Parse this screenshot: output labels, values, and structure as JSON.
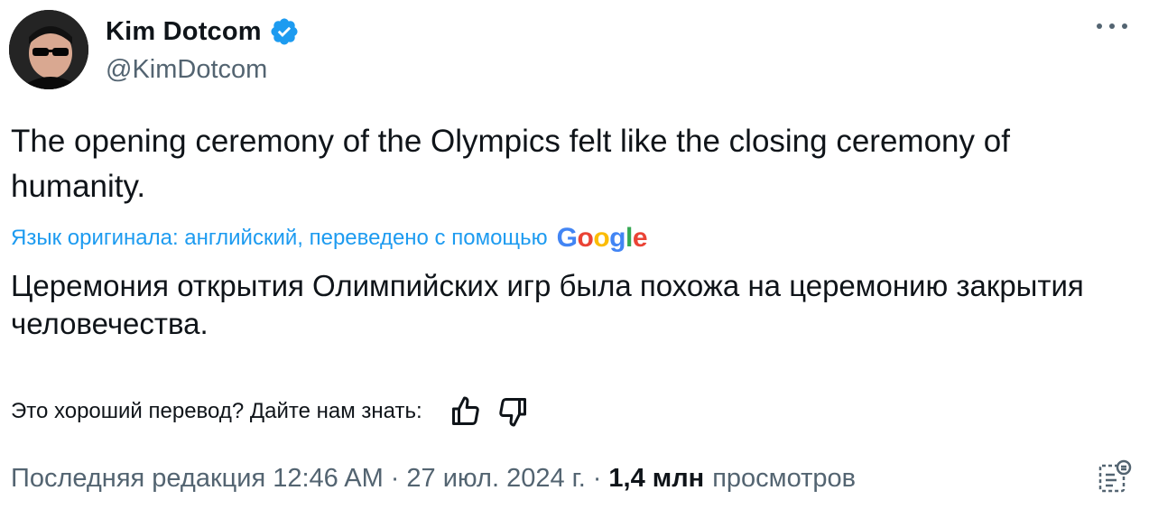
{
  "author": {
    "display_name": "Kim Dotcom",
    "handle": "@KimDotcom",
    "verified_icon": "verified-badge-icon",
    "verified_color": "#1d9bf0"
  },
  "tweet": {
    "text": "The opening ceremony of the Olympics felt like the closing ceremony of humanity."
  },
  "translation": {
    "note": "Язык оригинала: английский, переведено с помощью",
    "provider": "Google",
    "text": "Церемония открытия Олимпийских игр была похожа на церемонию закрытия человечества.",
    "feedback_question": "Это хороший перевод? Дайте нам знать:"
  },
  "meta": {
    "edited_label": "Последняя редакция",
    "time": "12:46 AM",
    "separator": "·",
    "date": "27 июл. 2024 г.",
    "views_count": "1,4 млн",
    "views_label": "просмотров"
  },
  "colors": {
    "text": "#0f1419",
    "secondary": "#536471",
    "link": "#1d9bf0"
  }
}
